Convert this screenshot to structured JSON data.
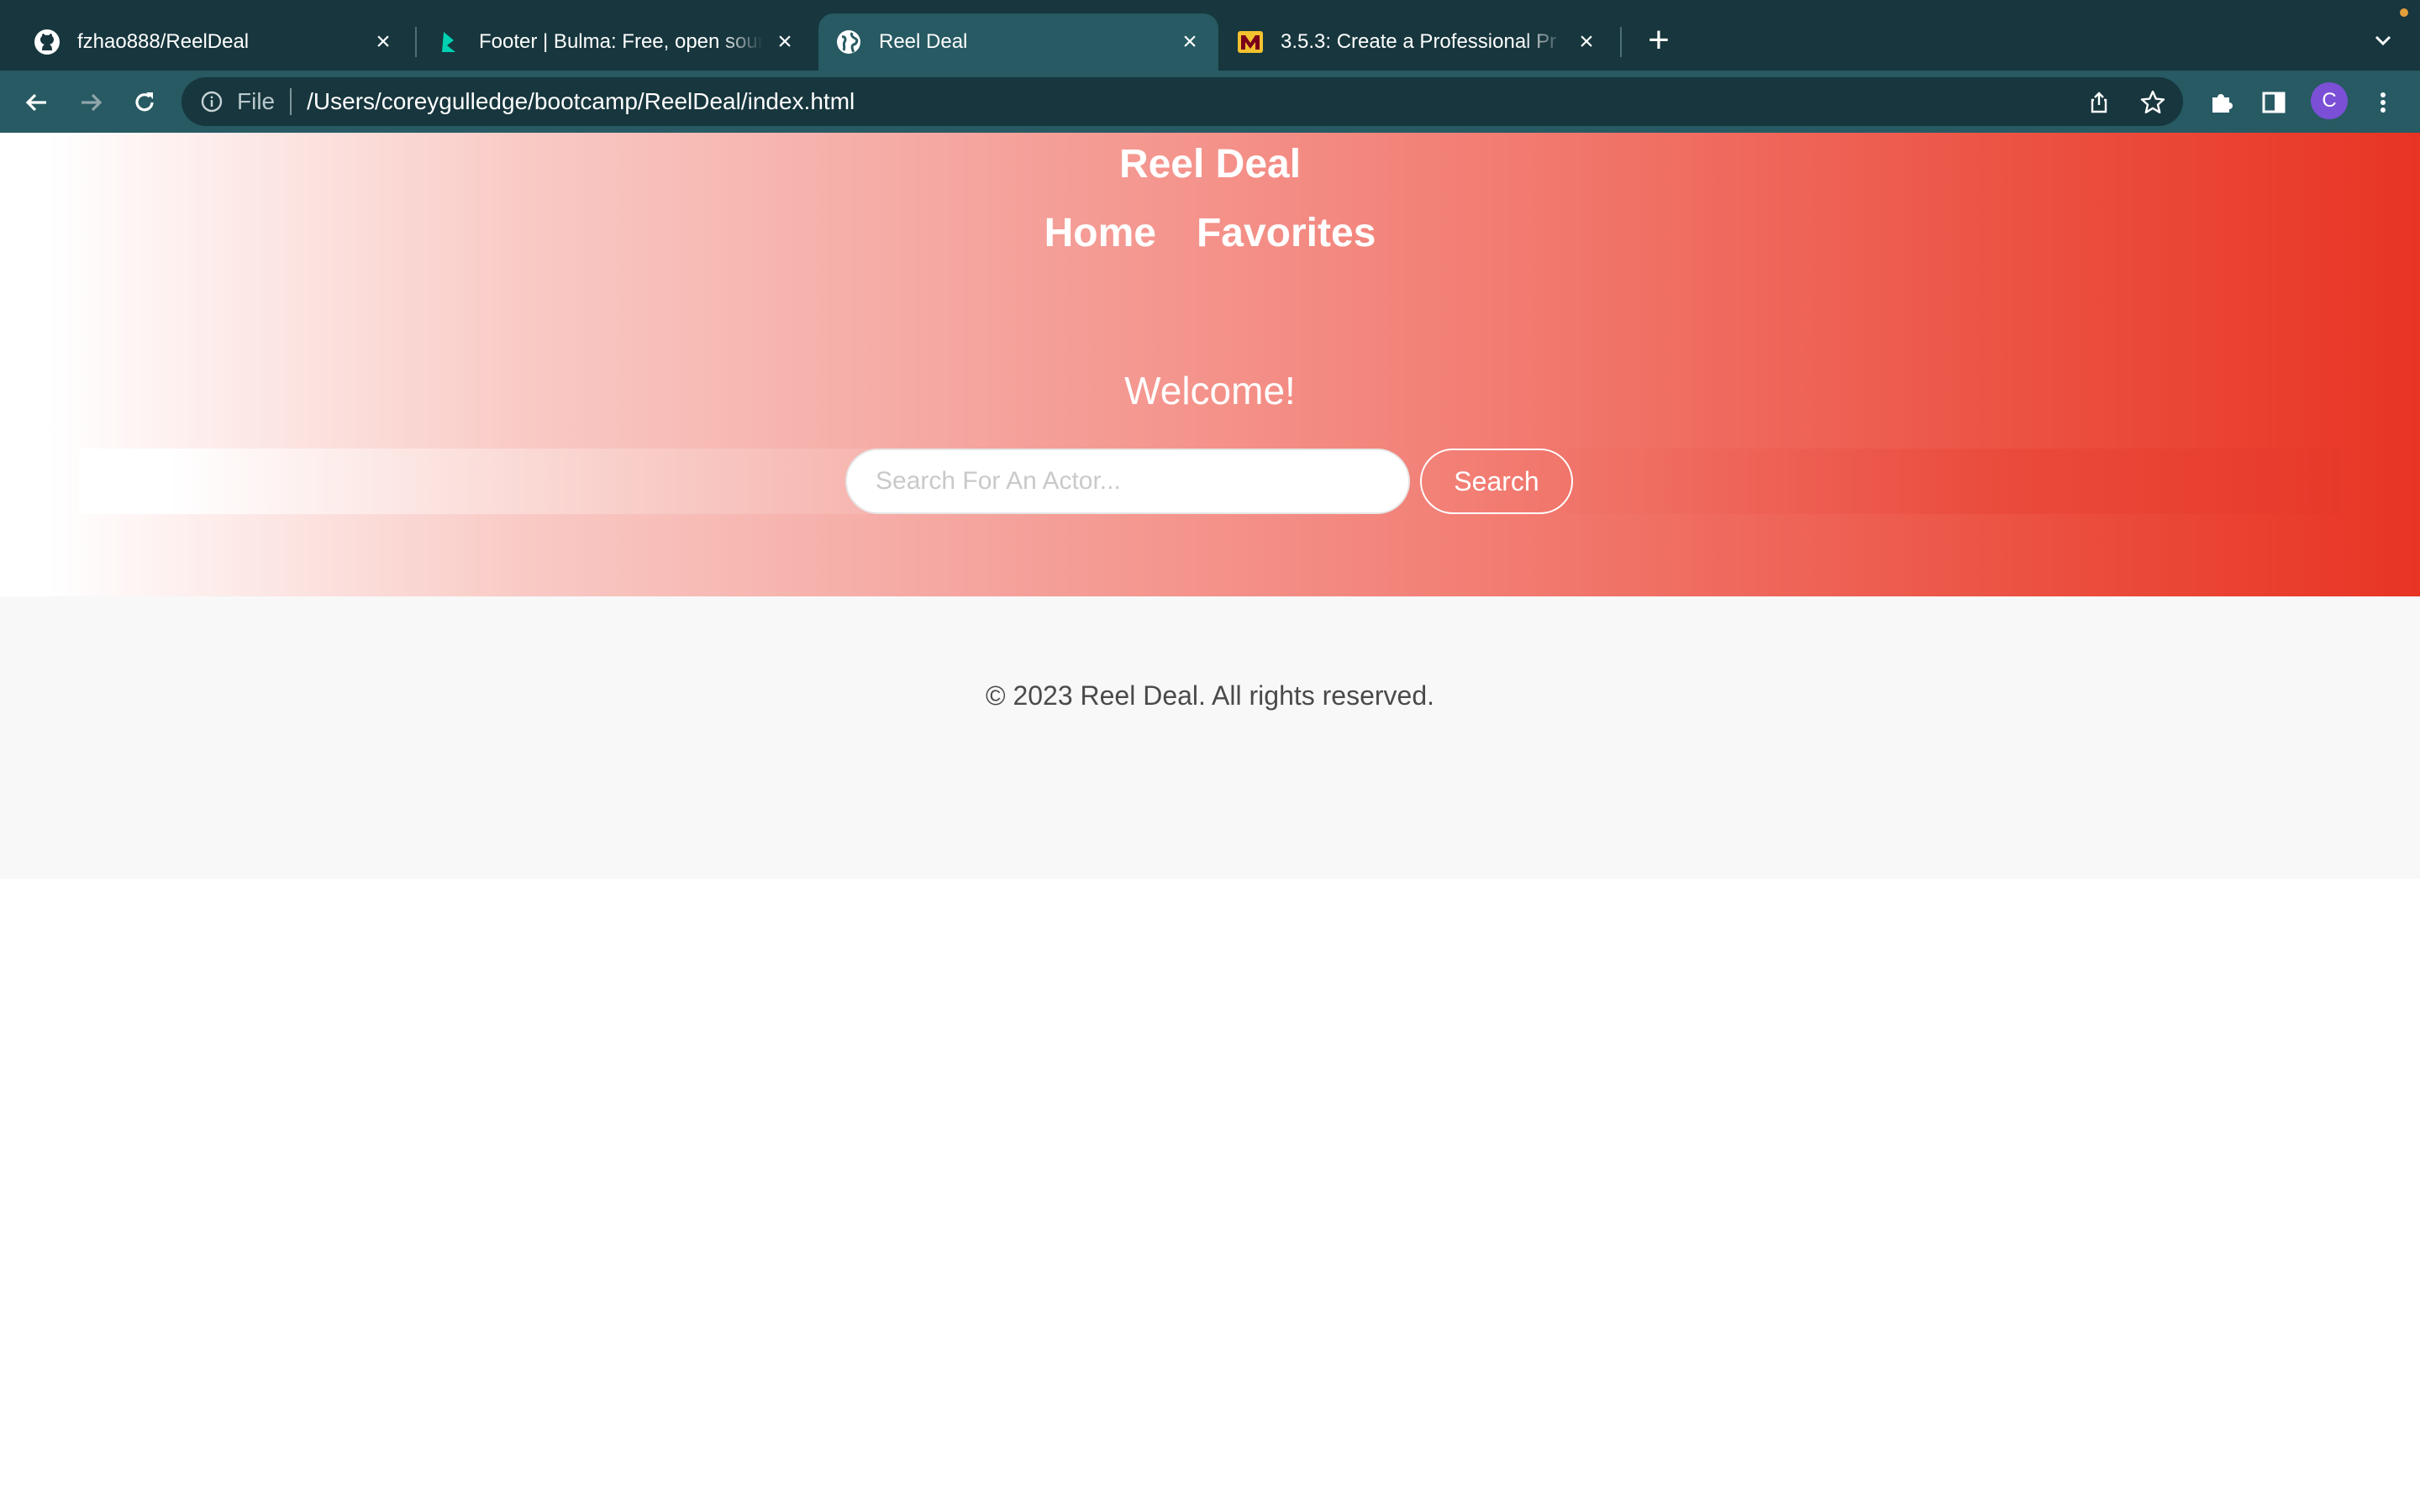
{
  "browser": {
    "tabs": [
      {
        "title": "fzhao888/ReelDeal",
        "icon": "github-icon",
        "active": false
      },
      {
        "title": "Footer | Bulma: Free, open sour",
        "icon": "bulma-icon",
        "active": false
      },
      {
        "title": "Reel Deal",
        "icon": "globe-icon",
        "active": true
      },
      {
        "title": "3.5.3: Create a Professional Pr",
        "icon": "course-icon",
        "active": false
      }
    ],
    "new_tab_label": "+",
    "address": {
      "scheme": "File",
      "url": "/Users/coreygulledge/bootcamp/ReelDeal/index.html"
    },
    "profile_initial": "C",
    "colors": {
      "tabstrip": "#17363d",
      "toolbar": "#275a63",
      "avatar": "#7b4fd6"
    }
  },
  "page": {
    "title": "Reel Deal",
    "nav": [
      {
        "label": "Home"
      },
      {
        "label": "Favorites"
      }
    ],
    "welcome": "Welcome!",
    "search": {
      "placeholder": "Search For An Actor...",
      "value": "",
      "button_label": "Search"
    },
    "footer": {
      "text": "© 2023 Reel Deal. All rights reserved."
    },
    "colors": {
      "gradient_start": "#ffffff",
      "gradient_end": "#e83424",
      "footer_bg": "#f8f8f8"
    }
  }
}
